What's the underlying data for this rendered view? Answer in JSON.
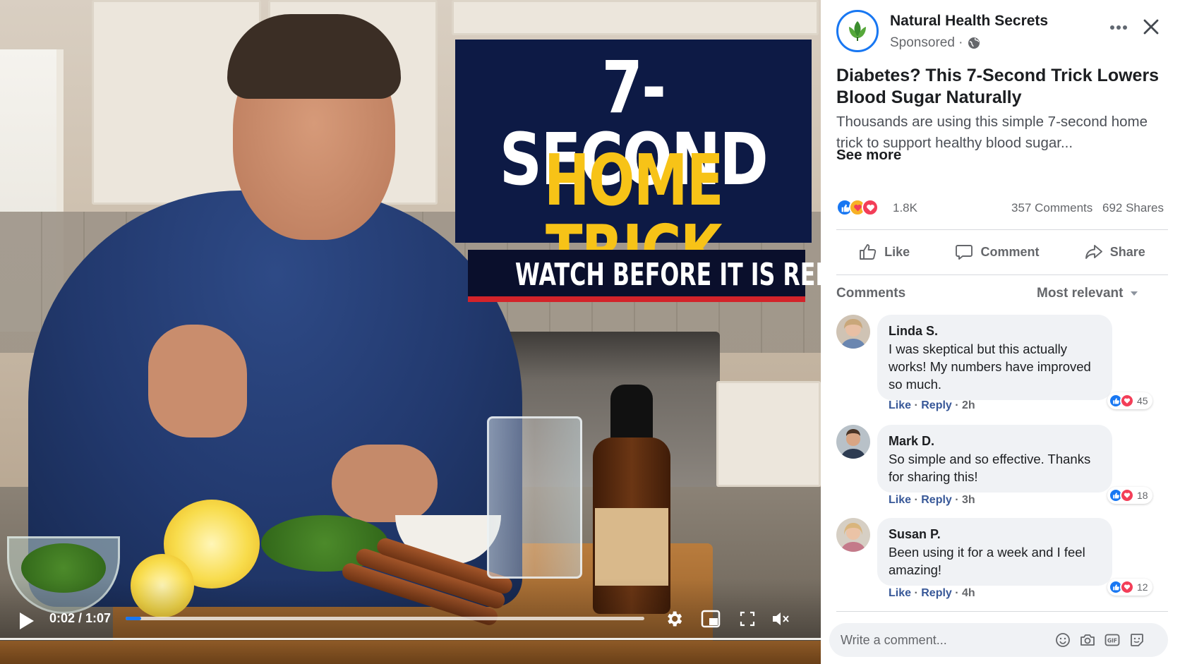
{
  "video": {
    "title_line1": "7-SECOND",
    "title_line2": "HOME TRICK",
    "subtitle": "WATCH BEFORE IT IS REMOVED",
    "time": "0:02 / 1:07",
    "progress": 0.03
  },
  "panel": {
    "page_name": "Natural Health Secrets",
    "sponsored": "Sponsored ·",
    "post_title": "Diabetes? This 7-Second Trick Lowers Blood Sugar Naturally",
    "post_body": "Thousands are using this simple 7-second home trick to support healthy blood sugar...",
    "see_more": "See more",
    "reactions_count": "1.8K",
    "comments_count": "357 Comments",
    "shares_count": "692 Shares",
    "actions": {
      "like": "Like",
      "comment": "Comment",
      "share": "Share"
    },
    "comments_header": "Comments",
    "sort_label": "Most relevant",
    "comments": [
      {
        "name": "Linda S.",
        "text": "I was skeptical but this actually works! My numbers have improved so much.",
        "like": "Like",
        "reply": "Reply",
        "time": "2h",
        "reactions": "45"
      },
      {
        "name": "Mark D.",
        "text": "So simple and so effective. Thanks for sharing this!",
        "like": "Like",
        "reply": "Reply",
        "time": "3h",
        "reactions": "18"
      },
      {
        "name": "Susan P.",
        "text": "Been using it for a week and I feel amazing!",
        "like": "Like",
        "reply": "Reply",
        "time": "4h",
        "reactions": "12"
      }
    ],
    "write_placeholder": "Write a comment...",
    "colors": {
      "accent": "#1877f2",
      "love": "#f33e58",
      "title_yellow": "#f7c317",
      "title_navy": "#0d1a45"
    }
  }
}
